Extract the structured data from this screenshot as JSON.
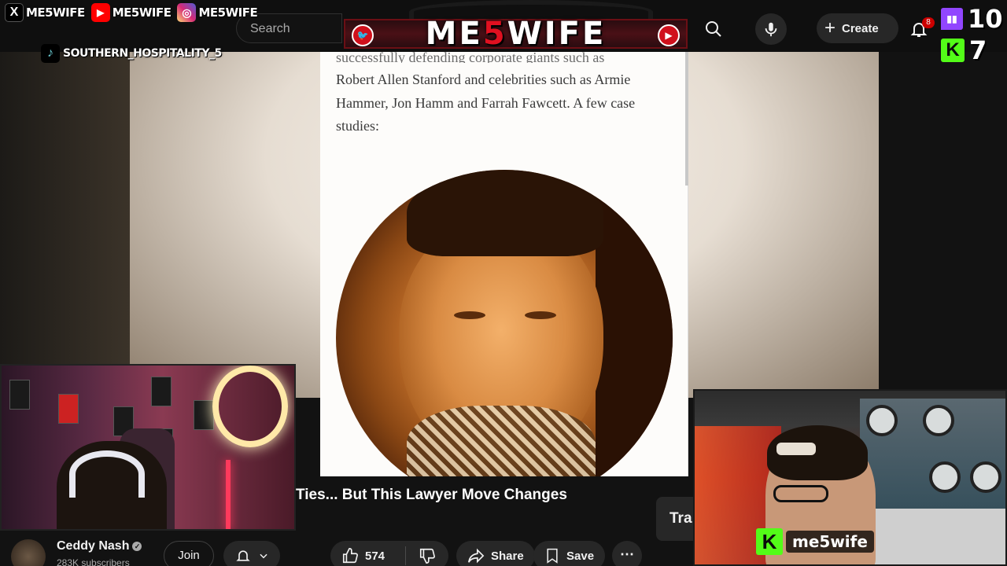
{
  "overlay": {
    "socials": [
      {
        "icon": "x-icon",
        "glyph": "X",
        "handle": "ME5WIFE",
        "color": "#000000"
      },
      {
        "icon": "youtube-icon",
        "glyph": "▶",
        "handle": "ME5WIFE",
        "color": "#ff0000"
      },
      {
        "icon": "instagram-icon",
        "glyph": "◎",
        "handle": "ME5WIFE",
        "color": "#d6249f"
      }
    ],
    "tiktok_handle": "SOUTHERN_HOSPITALITY_5",
    "logo": {
      "pre": "ME",
      "five": "5",
      "post": "WIFE"
    },
    "counters": {
      "twitch": "10",
      "kick": "7"
    },
    "kick_cam_tag": "me5wife"
  },
  "youtube": {
    "search_placeholder": "Search",
    "create_label": "Create",
    "notification_count": "8",
    "video_title": "Ties... But This Lawyer Move Changes",
    "side_peek": "Tra",
    "channel": {
      "name": "Ceddy Nash",
      "subscribers": "283K subscribers"
    },
    "join_label": "Join",
    "likes": "574",
    "share_label": "Share",
    "save_label": "Save"
  },
  "article": {
    "cut_line": "successfully defending corporate giants such as",
    "paragraph": "Robert Allen Stanford and celebrities such as Armie Hammer, Jon Hamm and Farrah Fawcett. A few case studies:"
  },
  "colors": {
    "accent_red": "#e01020",
    "twitch": "#9146ff",
    "kick": "#53fc18"
  }
}
